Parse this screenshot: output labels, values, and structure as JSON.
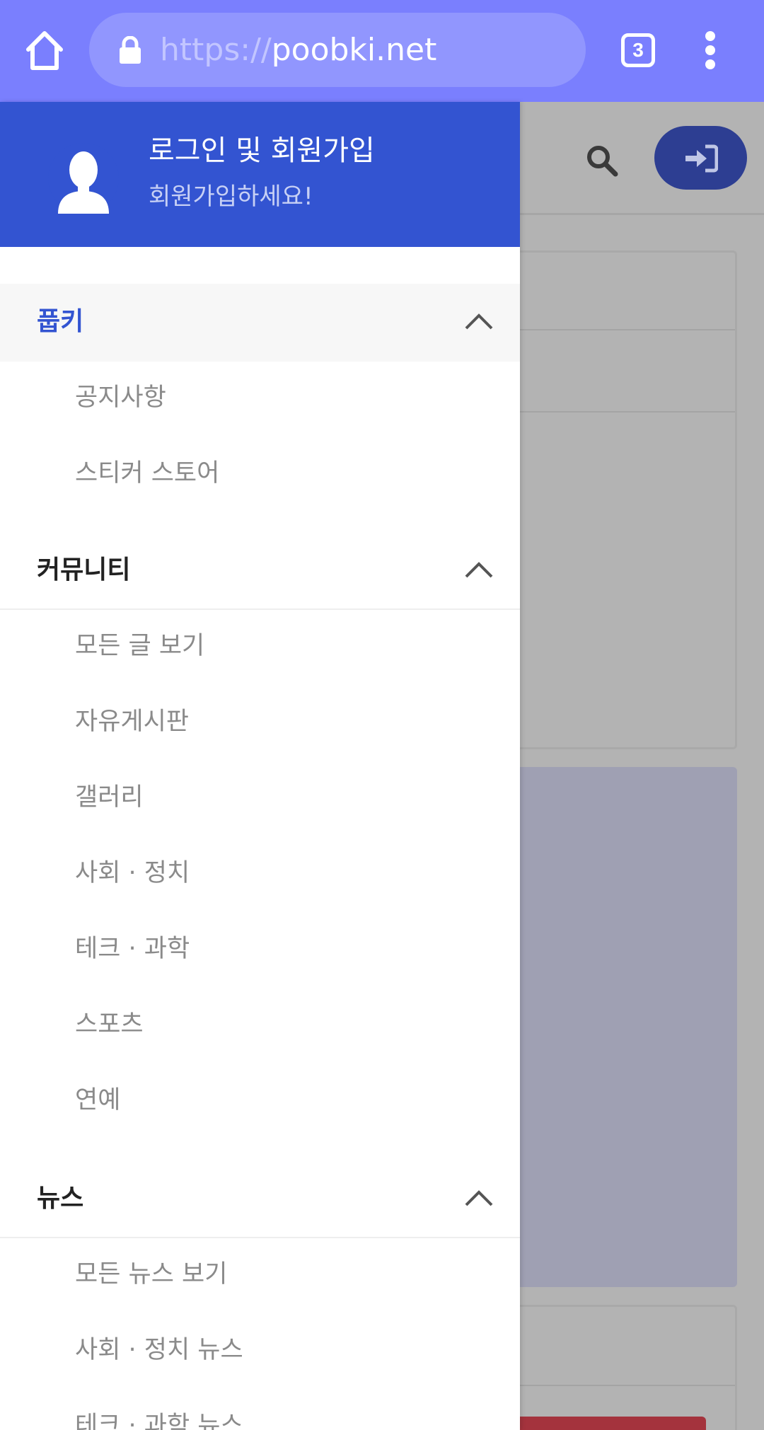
{
  "browser": {
    "url_scheme": "https://",
    "url_host": "poobki.net",
    "tab_count": "3"
  },
  "drawer": {
    "header": {
      "title": "로그인 및 회원가입",
      "subtitle": "회원가입하세요!"
    },
    "sections": [
      {
        "label": "풉키",
        "active": true,
        "items": [
          "공지사항",
          "스티커 스토어"
        ]
      },
      {
        "label": "커뮤니티",
        "active": false,
        "items": [
          "모든 글 보기",
          "자유게시판",
          "갤러리",
          "사회 · 정치",
          "테크 · 과학",
          "스포츠",
          "연예"
        ]
      },
      {
        "label": "뉴스",
        "active": false,
        "items": [
          "모든 뉴스 보기",
          "사회 · 정치 뉴스",
          "테크 · 과학 뉴스"
        ]
      }
    ]
  },
  "colors": {
    "chrome": "#7a7ffe",
    "drawer_header": "#3354d1",
    "active_text": "#3354d1",
    "item_text": "#8a8a8a"
  }
}
